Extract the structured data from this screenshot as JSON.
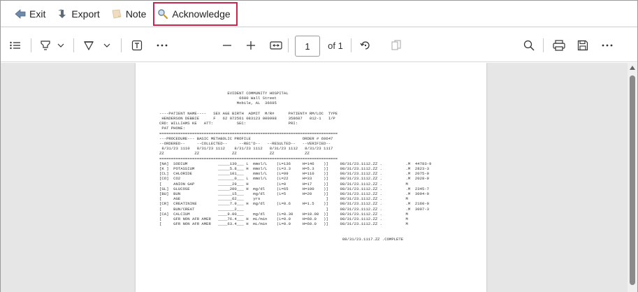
{
  "toolbar": {
    "exit_label": "Exit",
    "export_label": "Export",
    "note_label": "Note",
    "acknowledge_label": "Acknowledge"
  },
  "pdf_toolbar": {
    "page_number": "1",
    "page_of": "of 1"
  },
  "report": {
    "lines": [
      "                             EVIDENT COMMUNITY HOSPITAL",
      "                                  6600 Wall Street",
      "                                 Mobile, AL  36695",
      "",
      "----PATIENT NAME----   SEX AGE BIRTH  ADMIT  M/R#      PATIENT# RM/LOC  TYPE",
      " HENDERSON DEBBIE      F   62 072561 083123 000998     358687   012-1   I/P",
      "CRD: WILLIAMS KE   ATT:          SEC:                  PRI:",
      " PAT PHONE:",
      "============================================================================",
      "---PROCEDURE--- BASIC METABOLIC PROFILE                      ORDER # 69647",
      "--ORDERED--     --COLLECTED--     --REC'D--   --RESULTED--   --VERIFIED--",
      " 8/31/23 1110   8/31/23 1112    8/31/23 1112   8/31/23 1112   8/31/23 1117",
      "ZZ             ZZ              ZZ              ZZ             ZZ",
      "============================================================================",
      "[NA]  SODIUM             _____130___ L  mmol/L    (L=136     H=146    )]     08/31/23.1112.ZZ .          .M  44783-9",
      "[K ]  POTASSIUM          _____5.8___ H  mmol/L    (L=3.3     H=5.3    )]     08/31/23.1112.ZZ .          .M  2823-3",
      "[CL]  CHLORIDE           _____101___    mmol/L    (L=99      H=110    )]     08/31/23.1112.ZZ .          .M  2075-0",
      "[CO]  CO2                _______0___ L  mmol/L    (L=22      H=33     )]     08/31/23.1112.ZZ .          .M  2028-9",
      "[     ANION GAP          ______29___ H            (L=0       H=17     )]     08/31/23.1112.ZZ .          M",
      "[GL]  GLUCOSE            _____200___ H  mg/dl     (L=65      H=100    )]     08/31/23.1112.ZZ .          .M  2345-7",
      "[BU]  BUN                ______15___    mg/dl     (L=5       H=20     )]     08/31/23.1112.ZZ .          .M  3094-0",
      "[     AGE                ______62___    yrs                            ]     08/31/23.1112.ZZ .          M",
      "[CR]  CREATININE         _____7.9___ H  mg/dl     (L=0.6     H=1.5    )]     08/31/23.1112.ZZ .          .M  2160-0",
      "[     BUN/CREAT          _______2___                                   ]     08/31/23.1112.ZZ .          .M  3097-3",
      "[CA]  CALCIUM            ____9.00___    mg/dl     (L=8.30    H=10.00  )]     08/31/23.1112.ZZ .          M",
      "[     GFR NON AFR AMER   ____76.4___ H  mL/min    (L=0.0     H=60.0   )]     08/31/23.1112.ZZ .          M",
      "[     GFR NON AFR AMER   ____63.4___ H  mL/min    (L=0.0     H=60.0   )]     08/31/23.1112.ZZ .          M",
      "",
      "",
      "                                                                              08/31/23.1117.ZZ .COMPLETE"
    ]
  }
}
